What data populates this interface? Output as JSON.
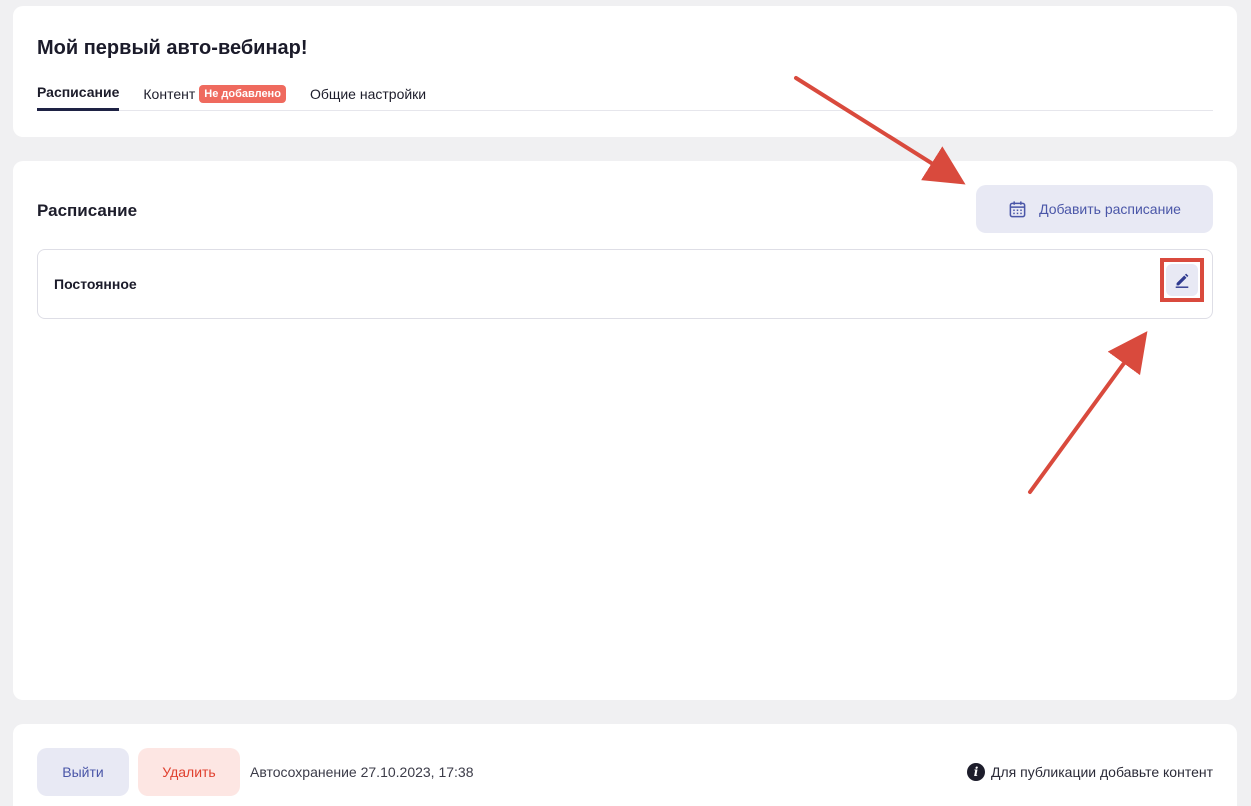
{
  "header": {
    "title": "Мой первый авто-вебинар!",
    "tabs": [
      {
        "label": "Расписание",
        "active": true
      },
      {
        "label": "Контент",
        "badge": "Не добавлено"
      },
      {
        "label": "Общие настройки"
      }
    ]
  },
  "schedule": {
    "title": "Расписание",
    "add_button_label": "Добавить расписание",
    "add_button_icon": "calendar-icon",
    "items": [
      {
        "name": "Постоянное",
        "edit_icon": "pencil-icon"
      }
    ]
  },
  "footer": {
    "exit_label": "Выйти",
    "delete_label": "Удалить",
    "autosave_text": "Автосохранение 27.10.2023, 17:38",
    "publish_hint": "Для публикации добавьте контент",
    "publish_hint_icon": "info-icon"
  },
  "colors": {
    "accent": "#4a56a8",
    "accent_bg": "#e8e9f4",
    "danger": "#e0402f",
    "danger_bg": "#fde6e3",
    "badge": "#ef6a5e",
    "annotation": "#d94a3d"
  }
}
